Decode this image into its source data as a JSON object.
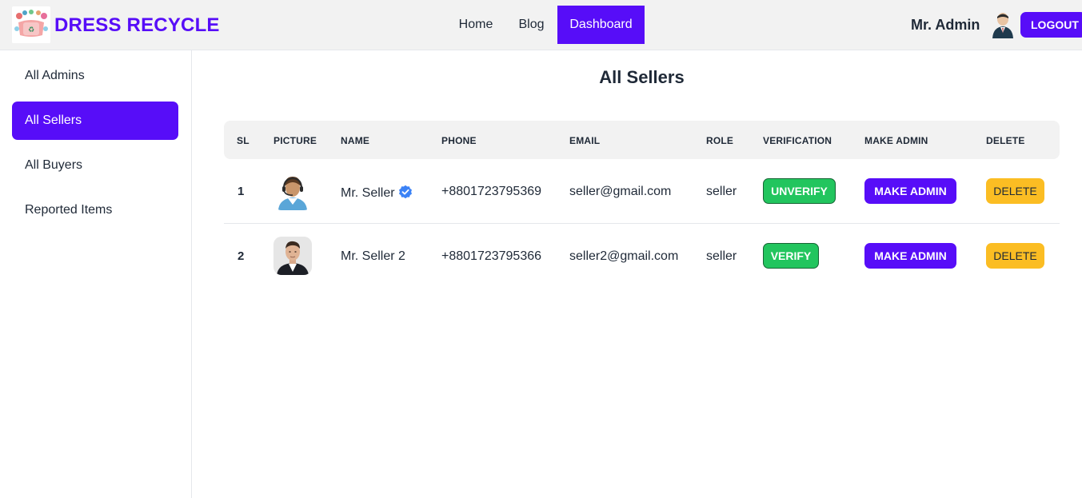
{
  "header": {
    "brand": "DRESS RECYCLE",
    "nav": [
      "Home",
      "Blog",
      "Dashboard"
    ],
    "admin_name": "Mr. Admin",
    "logout": "LOGOUT"
  },
  "sidebar": {
    "items": [
      {
        "label": "All Admins"
      },
      {
        "label": "All Sellers"
      },
      {
        "label": "All Buyers"
      },
      {
        "label": "Reported Items"
      }
    ]
  },
  "main": {
    "title": "All Sellers",
    "columns": [
      "SL",
      "PICTURE",
      "NAME",
      "PHONE",
      "EMAIL",
      "ROLE",
      "VERIFICATION",
      "MAKE ADMIN",
      "DELETE"
    ],
    "rows": [
      {
        "sl": "1",
        "name": "Mr. Seller",
        "verified_icon": "verified-badge-icon",
        "phone": "+8801723795369",
        "email": "seller@gmail.com",
        "role": "seller",
        "verification": "UNVERIFY",
        "make_admin": "MAKE ADMIN",
        "delete": "DELETE"
      },
      {
        "sl": "2",
        "name": "Mr. Seller 2",
        "phone": "+8801723795366",
        "email": "seller2@gmail.com",
        "role": "seller",
        "verification": "VERIFY",
        "make_admin": "MAKE ADMIN",
        "delete": "DELETE"
      }
    ]
  },
  "colors": {
    "primary": "#570df8",
    "success": "#22c55e",
    "warning": "#fbbd23",
    "header_bg": "#f2f2f2"
  }
}
